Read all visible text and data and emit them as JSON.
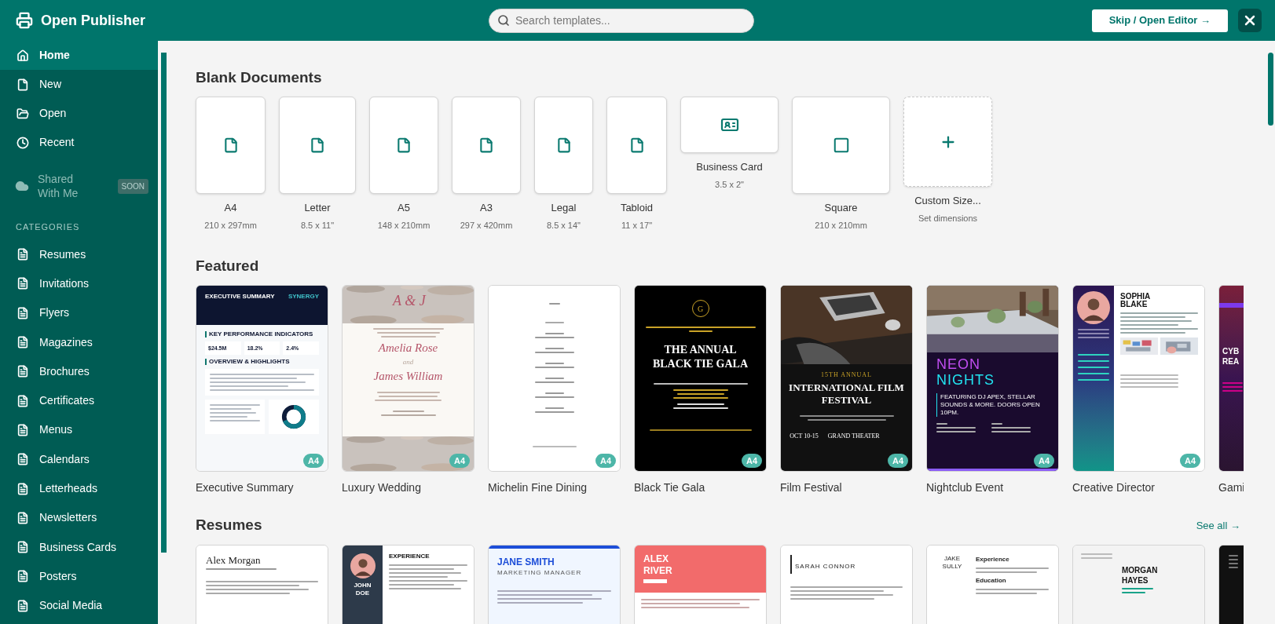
{
  "app": {
    "title": "Open Publisher"
  },
  "search": {
    "placeholder": "Search templates..."
  },
  "skip_button": "Skip / Open Editor →",
  "sidebar": {
    "nav": [
      {
        "label": "Home",
        "selected": true
      },
      {
        "label": "New",
        "selected": false
      },
      {
        "label": "Open",
        "selected": false
      },
      {
        "label": "Recent",
        "selected": false
      }
    ],
    "shared": {
      "label": "Shared With Me",
      "badge": "SOON",
      "disabled": true
    },
    "categories": {
      "heading": "CATEGORIES",
      "items": [
        "Resumes",
        "Invitations",
        "Flyers",
        "Magazines",
        "Brochures",
        "Certificates",
        "Menus",
        "Calendars",
        "Letterheads",
        "Newsletters",
        "Business Cards",
        "Posters",
        "Social Media"
      ]
    }
  },
  "blank_documents": {
    "title": "Blank Documents",
    "items": [
      {
        "kind": "page",
        "name": "A4",
        "size": "210 x 297mm"
      },
      {
        "kind": "page",
        "name": "Letter",
        "size": "8.5 x 11\""
      },
      {
        "kind": "page",
        "name": "A5",
        "size": "148 x 210mm"
      },
      {
        "kind": "page",
        "name": "A3",
        "size": "297 x 420mm"
      },
      {
        "kind": "page",
        "name": "Legal",
        "size": "8.5 x 14\""
      },
      {
        "kind": "page",
        "name": "Tabloid",
        "size": "11 x 17\""
      },
      {
        "kind": "card",
        "name": "Business Card",
        "size": "3.5 x 2\""
      },
      {
        "kind": "square",
        "name": "Square",
        "size": "210 x 210mm"
      },
      {
        "kind": "custom",
        "name": "Custom Size...",
        "size": "Set dimensions"
      }
    ]
  },
  "featured": {
    "title": "Featured",
    "items": [
      {
        "name": "Executive Summary",
        "badge": "A4",
        "preview": {
          "kind": "report",
          "title": "EXECUTIVE SUMMARY",
          "logo": "SYNERGY",
          "section_1": "KEY PERFORMANCE INDICATORS",
          "kpis": [
            "$24.5M",
            "18.2%",
            "2.4%"
          ],
          "section_2": "OVERVIEW & HIGHLIGHTS"
        }
      },
      {
        "name": "Luxury Wedding",
        "badge": "A4",
        "preview": {
          "kind": "wedding",
          "monogram": "A & J",
          "name_1": "Amelia Rose",
          "joiner": "and",
          "name_2": "James William"
        }
      },
      {
        "name": "Michelin Fine Dining",
        "badge": "A4",
        "preview": {
          "kind": "menu"
        }
      },
      {
        "name": "Black Tie Gala",
        "badge": "A4",
        "preview": {
          "kind": "gala",
          "monogram": "G",
          "title": "THE ANNUAL BLACK TIE GALA"
        }
      },
      {
        "name": "Film Festival",
        "badge": "A4",
        "preview": {
          "kind": "film",
          "overline": "15TH ANNUAL",
          "title": "INTERNATIONAL FILM FESTIVAL",
          "details": [
            "OCT 10-15",
            "GRAND THEATER"
          ]
        }
      },
      {
        "name": "Nightclub Event",
        "badge": "A4",
        "preview": {
          "kind": "neon",
          "title_1": "NEON",
          "title_2": "NIGHTS",
          "text": "FEATURING DJ APEX, STELLAR SOUNDS & MORE. DOORS OPEN 10PM."
        }
      },
      {
        "name": "Creative Director",
        "badge": "A4",
        "preview": {
          "kind": "profile",
          "title": "SOPHIA BLAKE"
        }
      },
      {
        "name": "Gami",
        "preview": {
          "kind": "gaming",
          "title": "CYB REA"
        }
      }
    ]
  },
  "resumes": {
    "title": "Resumes",
    "see_all": "See all →",
    "items": [
      {
        "kind": "classic",
        "title": "Alex Morgan"
      },
      {
        "kind": "sidebar",
        "title": "JOHN DOE",
        "heading": "EXPERIENCE"
      },
      {
        "kind": "banner",
        "title": "JANE SMITH",
        "subtitle": "MARKETING MANAGER"
      },
      {
        "kind": "coral",
        "title": "ALEX RIVER"
      },
      {
        "kind": "bar",
        "title": "SARAH CONNOR"
      },
      {
        "kind": "columns",
        "title": "JAKE SULLY",
        "headings": [
          "Experience",
          "Education"
        ]
      },
      {
        "kind": "grey",
        "title": "MORGAN HAYES"
      },
      {
        "kind": "dark"
      }
    ]
  }
}
